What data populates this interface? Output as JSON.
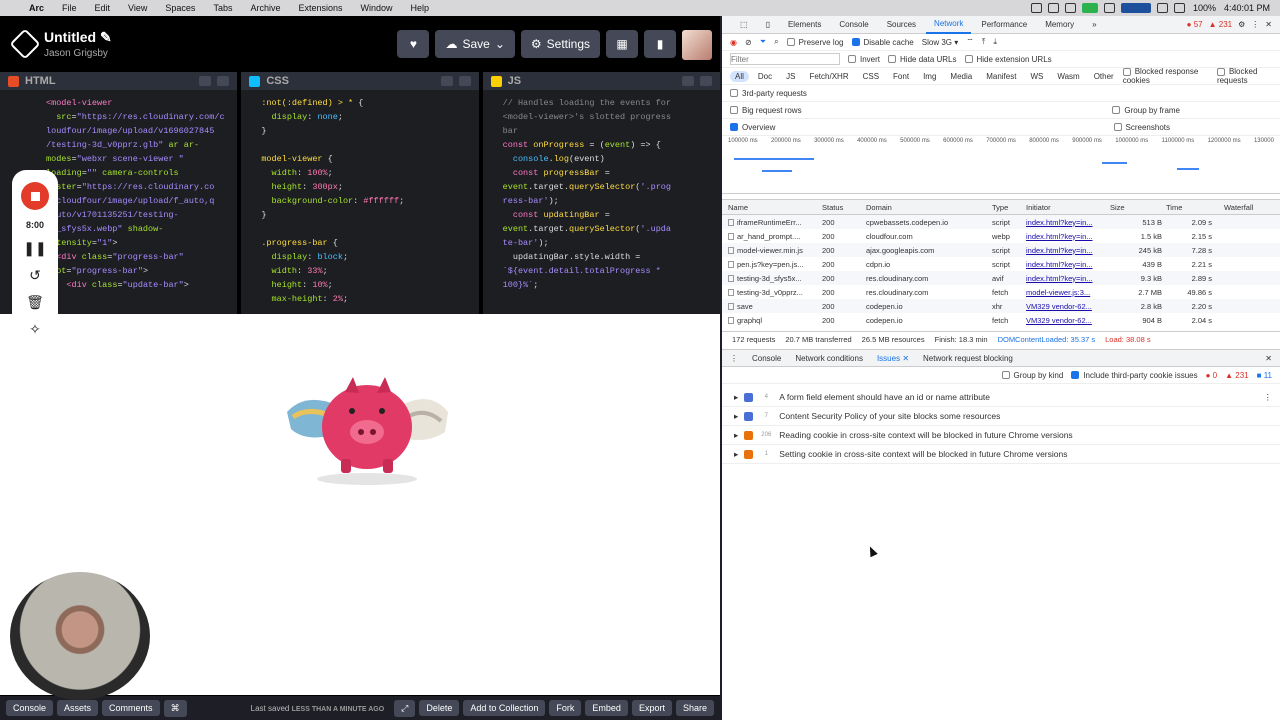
{
  "menubar": {
    "app": "Arc",
    "items": [
      "File",
      "Edit",
      "View",
      "Spaces",
      "Tabs",
      "Archive",
      "Extensions",
      "Window",
      "Help"
    ],
    "battery": "100%",
    "clock": "4:40:01 PM"
  },
  "codepen": {
    "title": "Untitled",
    "author": "Jason Grigsby",
    "save_label": "Save",
    "settings_label": "Settings",
    "editors": {
      "html": {
        "label": "HTML"
      },
      "css": {
        "label": "CSS"
      },
      "js": {
        "label": "JS"
      }
    },
    "recorder": {
      "time": "8:00"
    },
    "footer": {
      "console": "Console",
      "assets": "Assets",
      "comments": "Comments",
      "last_saved": "Last saved",
      "last_saved_when": "LESS THAN A MINUTE AGO",
      "delete": "Delete",
      "add_to_collection": "Add to Collection",
      "fork": "Fork",
      "embed": "Embed",
      "export": "Export",
      "share": "Share"
    }
  },
  "devtools": {
    "tabs": [
      "Elements",
      "Console",
      "Sources",
      "Network",
      "Performance",
      "Memory"
    ],
    "active_tab": "Network",
    "errors": "57",
    "warnings": "231",
    "toolbar": {
      "preserve_log": "Preserve log",
      "disable_cache": "Disable cache",
      "throttle": "Slow 3G"
    },
    "filter": {
      "placeholder": "Filter",
      "invert": "Invert",
      "hide_data_urls": "Hide data URLs",
      "hide_extension_urls": "Hide extension URLs"
    },
    "types": [
      "All",
      "Doc",
      "JS",
      "Fetch/XHR",
      "CSS",
      "Font",
      "Img",
      "Media",
      "Manifest",
      "WS",
      "Wasm",
      "Other"
    ],
    "blocked_response_cookies": "Blocked response cookies",
    "blocked_requests": "Blocked requests",
    "third_party": "3rd-party requests",
    "big_request_rows": "Big request rows",
    "group_by_frame": "Group by frame",
    "overview": "Overview",
    "screenshots": "Screenshots",
    "timeline_ticks": [
      "100000 ms",
      "200000 ms",
      "300000 ms",
      "400000 ms",
      "500000 ms",
      "600000 ms",
      "700000 ms",
      "800000 ms",
      "900000 ms",
      "1000000 ms",
      "1100000 ms",
      "1200000 ms",
      "130000"
    ],
    "columns": [
      "Name",
      "Status",
      "Domain",
      "Type",
      "Initiator",
      "Size",
      "Time",
      "Waterfall"
    ],
    "rows": [
      {
        "name": "iframeRuntimeErr...",
        "status": "200",
        "domain": "cpwebassets.codepen.io",
        "type": "script",
        "initiator": "index.html?key=in...",
        "size": "513 B",
        "time": "2.09 s"
      },
      {
        "name": "ar_hand_prompt....",
        "status": "200",
        "domain": "cloudfour.com",
        "type": "webp",
        "initiator": "index.html?key=in...",
        "size": "1.5 kB",
        "time": "2.15 s"
      },
      {
        "name": "model-viewer.min.js",
        "status": "200",
        "domain": "ajax.googleapis.com",
        "type": "script",
        "initiator": "index.html?key=in...",
        "size": "245 kB",
        "time": "7.28 s"
      },
      {
        "name": "pen.js?key=pen.js...",
        "status": "200",
        "domain": "cdpn.io",
        "type": "script",
        "initiator": "index.html?key=in...",
        "size": "439 B",
        "time": "2.21 s"
      },
      {
        "name": "testing-3d_sfys5x...",
        "status": "200",
        "domain": "res.cloudinary.com",
        "type": "avif",
        "initiator": "index.html?key=in...",
        "size": "9.3 kB",
        "time": "2.89 s"
      },
      {
        "name": "testing-3d_v0pprz...",
        "status": "200",
        "domain": "res.cloudinary.com",
        "type": "fetch",
        "initiator": "model-viewer.js:3...",
        "size": "2.7 MB",
        "time": "49.86 s"
      },
      {
        "name": "save",
        "status": "200",
        "domain": "codepen.io",
        "type": "xhr",
        "initiator": "VM329 vendor-62...",
        "size": "2.8 kB",
        "time": "2.20 s"
      },
      {
        "name": "graphql",
        "status": "200",
        "domain": "codepen.io",
        "type": "fetch",
        "initiator": "VM329 vendor-62...",
        "size": "904 B",
        "time": "2.04 s"
      }
    ],
    "statusbar": {
      "requests": "172 requests",
      "transferred": "20.7 MB transferred",
      "resources": "26.5 MB resources",
      "finish": "Finish: 18.3 min",
      "dcl": "DOMContentLoaded: 35.37 s",
      "load": "Load: 38.08 s"
    },
    "drawer_tabs": [
      "Console",
      "Network conditions",
      "Issues",
      "Network request blocking"
    ],
    "group_by_kind": "Group by kind",
    "include_third_party": "Include third-party cookie issues",
    "issue_counts": {
      "errors": "0",
      "warnings": "231",
      "info": "11"
    },
    "issues": [
      {
        "count": "4",
        "kind": "info",
        "text": "A form field element should have an id or name attribute"
      },
      {
        "count": "7",
        "kind": "info",
        "text": "Content Security Policy of your site blocks some resources"
      },
      {
        "count": "206",
        "kind": "warn",
        "text": "Reading cookie in cross-site context will be blocked in future Chrome versions"
      },
      {
        "count": "1",
        "kind": "warn",
        "text": "Setting cookie in cross-site context will be blocked in future Chrome versions"
      }
    ]
  }
}
